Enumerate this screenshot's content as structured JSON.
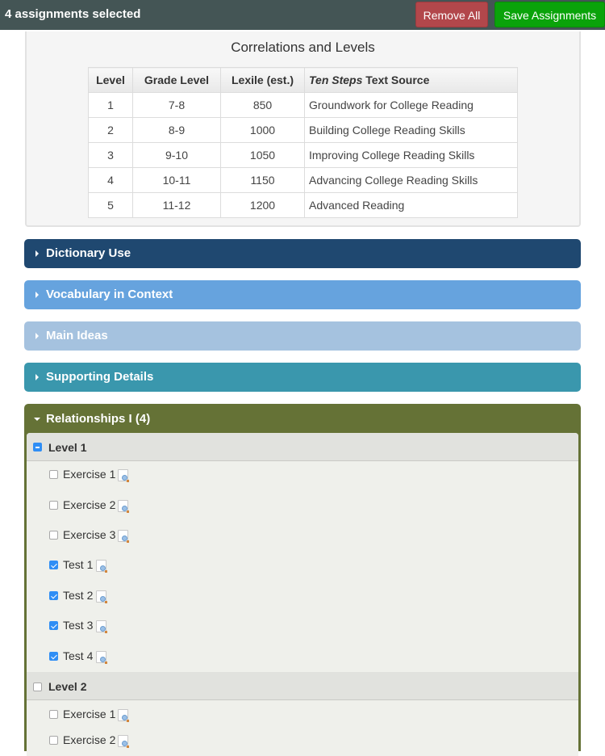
{
  "topbar": {
    "selected_count_text": "4 assignments selected",
    "remove_all_label": "Remove All",
    "save_label": "Save Assignments"
  },
  "correlations": {
    "title": "Correlations and Levels",
    "headers": {
      "level": "Level",
      "grade": "Grade Level",
      "lexile": "Lexile (est.)",
      "source_em": "Ten Steps",
      "source_rest": " Text Source"
    },
    "rows": [
      {
        "level": "1",
        "grade": "7-8",
        "lexile": "850",
        "source": "Groundwork for College Reading"
      },
      {
        "level": "2",
        "grade": "8-9",
        "lexile": "1000",
        "source": "Building College Reading Skills"
      },
      {
        "level": "3",
        "grade": "9-10",
        "lexile": "1050",
        "source": "Improving College Reading Skills"
      },
      {
        "level": "4",
        "grade": "10-11",
        "lexile": "1150",
        "source": "Advancing College Reading Skills"
      },
      {
        "level": "5",
        "grade": "11-12",
        "lexile": "1200",
        "source": "Advanced Reading"
      }
    ]
  },
  "sections": [
    {
      "label": "Dictionary Use",
      "color": "#1f4870",
      "expanded": false
    },
    {
      "label": "Vocabulary in Context",
      "color": "#66a3de",
      "expanded": false
    },
    {
      "label": "Main Ideas",
      "color": "#a5c2df",
      "expanded": false
    },
    {
      "label": "Supporting Details",
      "color": "#3a97ad",
      "expanded": false
    },
    {
      "label": "Relationships I (4)",
      "color": "#657236",
      "expanded": true
    }
  ],
  "relationships": {
    "levels": [
      {
        "label": "Level 1",
        "state": "mixed",
        "items": [
          {
            "label": "Exercise 1",
            "checked": false
          },
          {
            "label": "Exercise 2",
            "checked": false
          },
          {
            "label": "Exercise 3",
            "checked": false
          },
          {
            "label": "Test 1",
            "checked": true
          },
          {
            "label": "Test 2",
            "checked": true
          },
          {
            "label": "Test 3",
            "checked": true
          },
          {
            "label": "Test 4",
            "checked": true
          }
        ]
      },
      {
        "label": "Level 2",
        "state": "unchecked",
        "items": [
          {
            "label": "Exercise 1",
            "checked": false
          },
          {
            "label": "Exercise 2",
            "checked": false
          }
        ]
      }
    ]
  }
}
